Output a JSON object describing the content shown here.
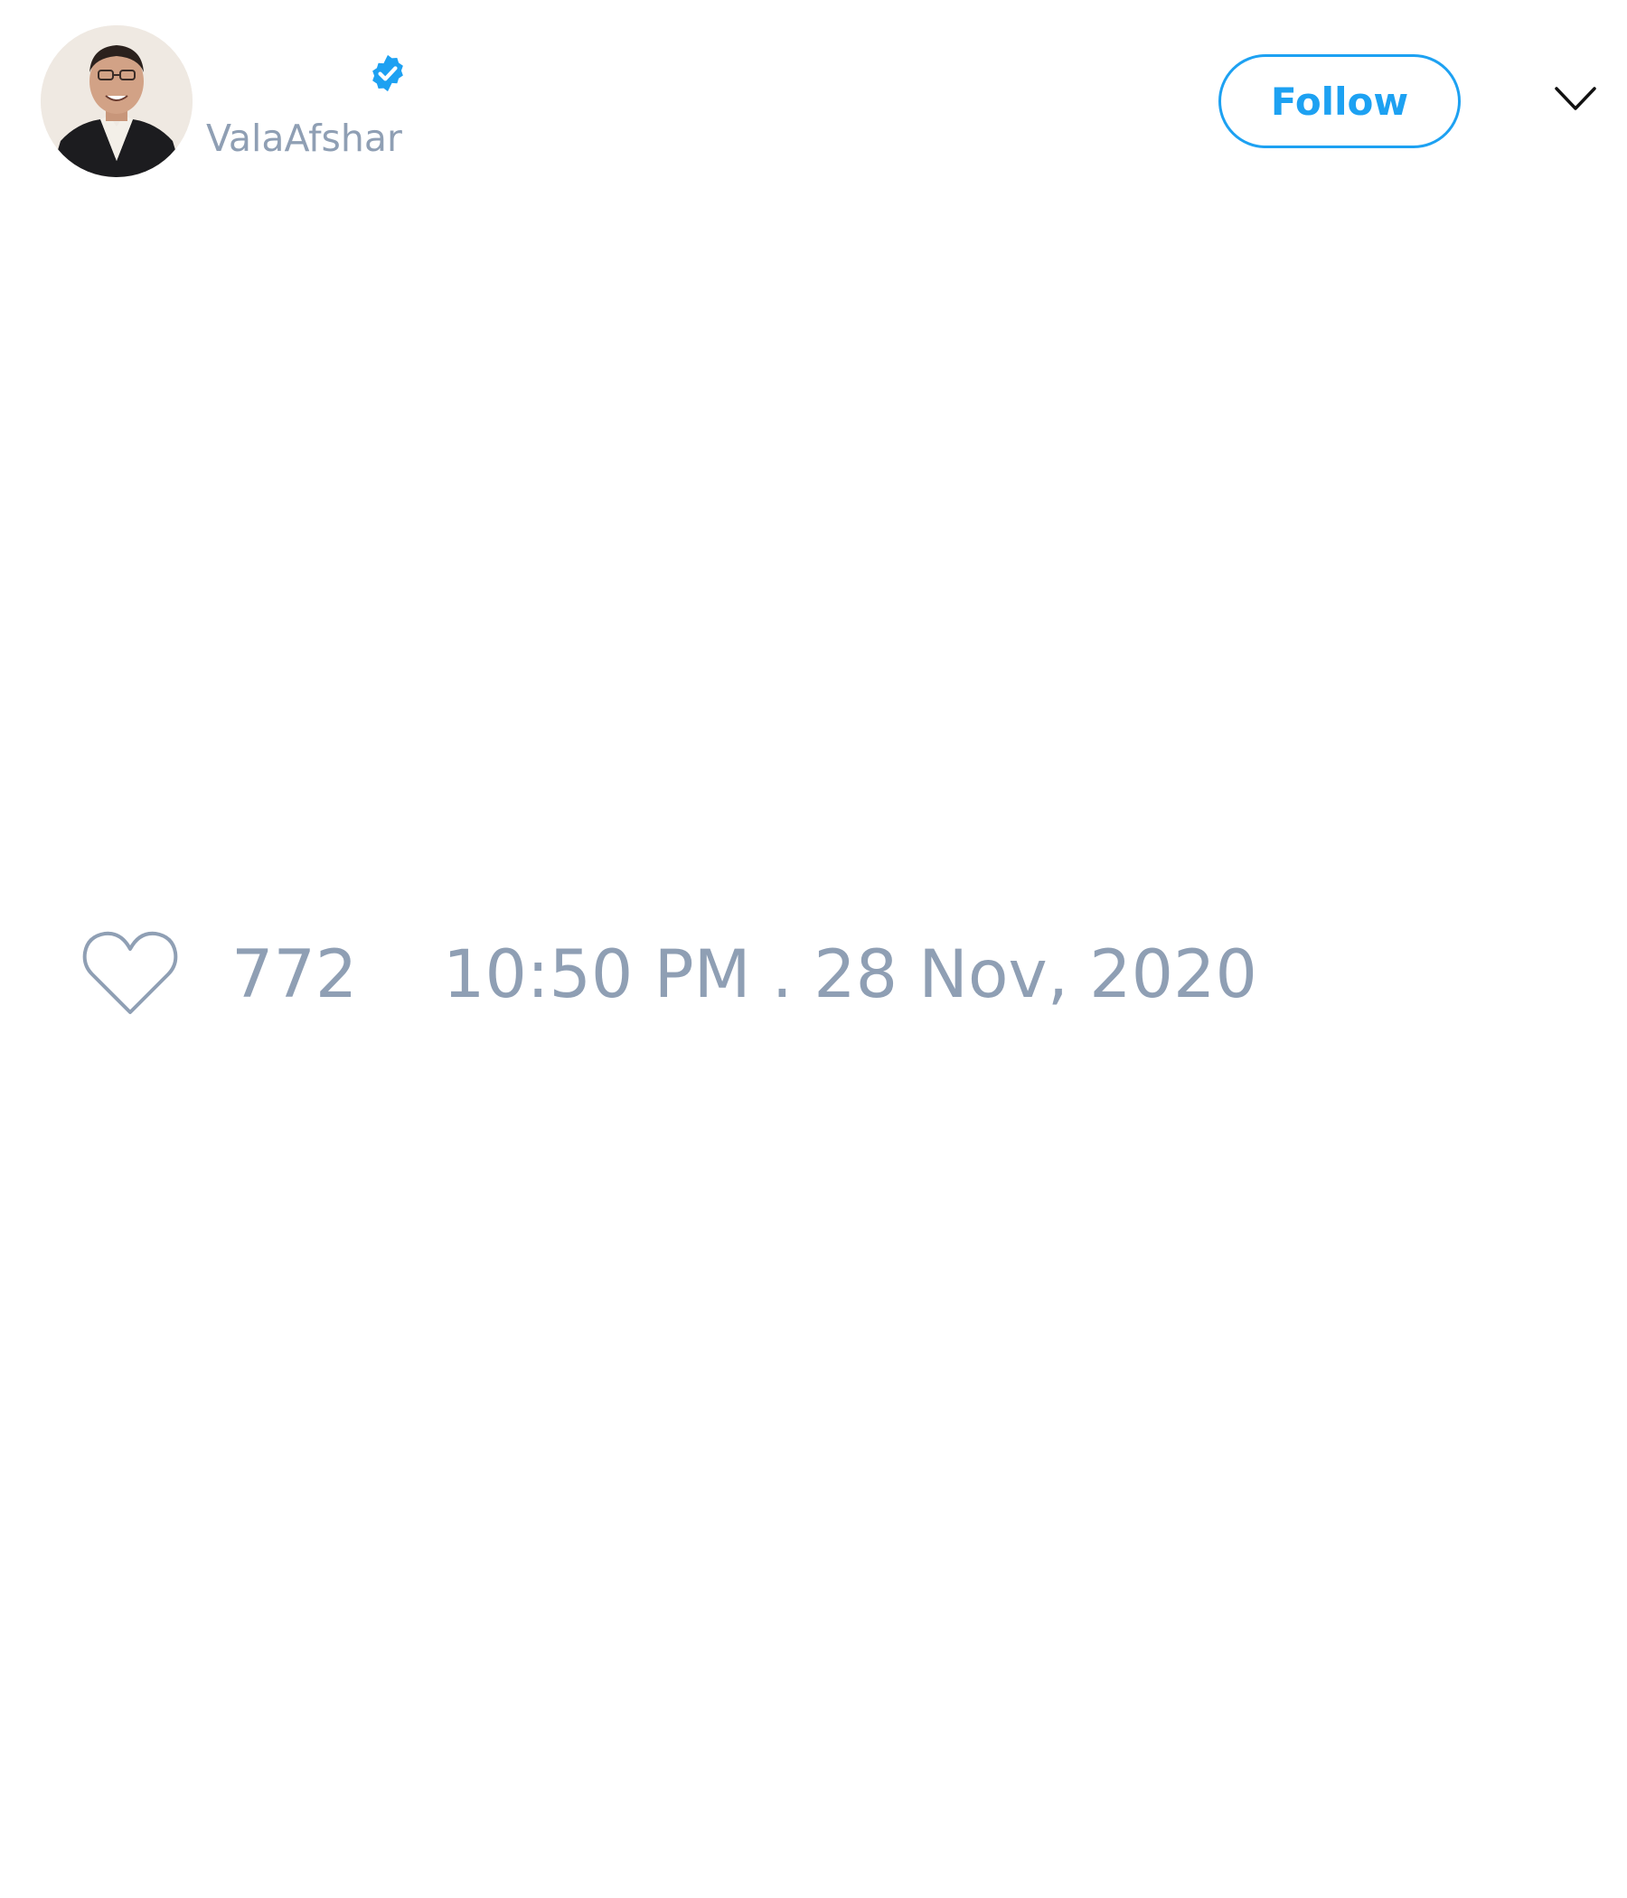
{
  "tweet": {
    "author": {
      "handle": "ValaAfshar",
      "verified": true,
      "avatar_icon": "profile-photo-man-in-suit"
    },
    "follow_label": "Follow",
    "menu_icon": "chevron-down-icon",
    "likes": {
      "icon": "heart-icon",
      "count": "772"
    },
    "timestamp": "10:50 PM . 28 Nov, 2020"
  },
  "colors": {
    "accent": "#1da1f2",
    "muted_text": "#8f9fb4",
    "background": "#ffffff"
  }
}
